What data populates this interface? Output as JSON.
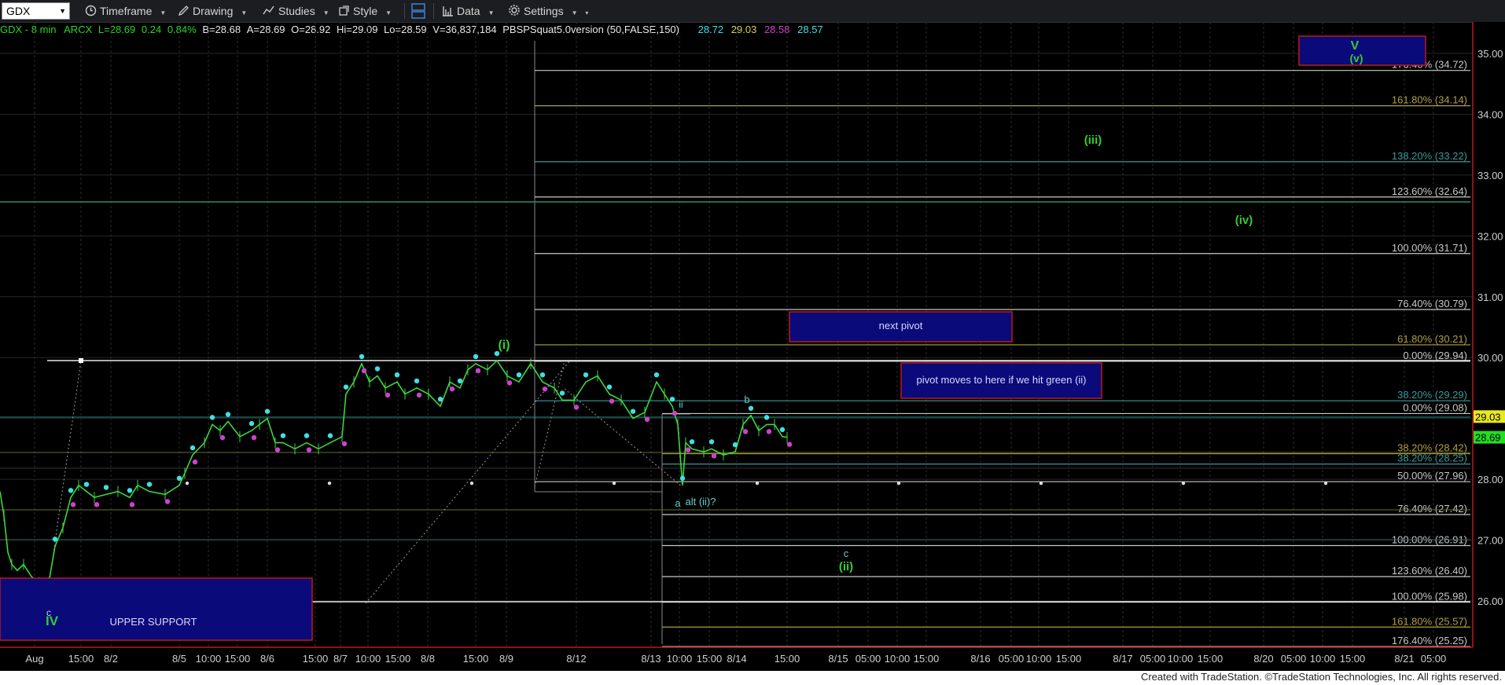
{
  "toolbar": {
    "symbol": "GDX",
    "timeframe": "Timeframe",
    "drawing": "Drawing",
    "studies": "Studies",
    "style": "Style",
    "data": "Data",
    "settings": "Settings"
  },
  "info": {
    "symbol_interval": "GDX - 8 min",
    "exchange": "ARCX",
    "last": "L=28.69",
    "change": "0.24",
    "change_pct": "0.84%",
    "bid": "B=28.68",
    "ask": "A=28.69",
    "open": "O=28.92",
    "high": "Hi=29.09",
    "low": "Lo=28.59",
    "volume": "V=36,837,184",
    "study": "PBSPSquat5.0version (50,FALSE,150)",
    "study_v1": "28.72",
    "study_v2": "29.03",
    "study_v3": "28.58",
    "study_v4": "28.57"
  },
  "colors": {
    "up": "#22c22a",
    "down": "#e03030",
    "candle": "#3dd63d",
    "dot_cyan": "#3fe0e0",
    "dot_magenta": "#d040d0",
    "wave_green": "#33cc33",
    "fib_gray": "#c8c8c8",
    "box_fill": "#0a0a7a",
    "box_border": "#c01818"
  },
  "price_axis": {
    "labels": [
      "35.00",
      "34.00",
      "33.00",
      "32.00",
      "31.00",
      "30.00",
      "29.00",
      "28.00",
      "27.00",
      "26.00"
    ],
    "last_price": "28.69",
    "marker_price": "29.03"
  },
  "time_axis": {
    "labels": [
      "Aug",
      "15:00",
      "8/2",
      "8/5",
      "10:00",
      "15:00",
      "8/6",
      "15:00",
      "8/7",
      "10:00",
      "15:00",
      "8/8",
      "15:00",
      "8/9",
      "8/12",
      "8/13",
      "10:00",
      "15:00",
      "8/14",
      "15:00",
      "8/15",
      "05:00",
      "10:00",
      "15:00",
      "8/16",
      "05:00",
      "10:00",
      "15:00",
      "8/17",
      "05:00",
      "10:00",
      "15:00",
      "8/20",
      "05:00",
      "10:00",
      "15:00",
      "8/21",
      "05:00"
    ]
  },
  "fib_levels": [
    {
      "label": "176.40% (34.72)",
      "price": 34.72,
      "color": "#c8c8c8"
    },
    {
      "label": "161.80% (34.14)",
      "price": 34.14,
      "color": "#b0a040"
    },
    {
      "label": "138.20% (33.22)",
      "price": 33.22,
      "color": "#3a9a9a"
    },
    {
      "label": "123.60% (32.64)",
      "price": 32.64,
      "color": "#c8c8c8"
    },
    {
      "label": "100.00% (31.71)",
      "price": 31.71,
      "color": "#c8c8c8"
    },
    {
      "label": "76.40% (30.79)",
      "price": 30.79,
      "color": "#c8c8c8"
    },
    {
      "label": "61.80% (30.21)",
      "price": 30.21,
      "color": "#b0a040"
    },
    {
      "label": "0.00% (29.94)",
      "price": 29.94,
      "color": "#c8c8c8"
    },
    {
      "label": "38.20% (29.29)",
      "price": 29.29,
      "color": "#3a9a9a"
    },
    {
      "label": "0.00% (29.08)",
      "price": 29.08,
      "color": "#c8c8c8"
    },
    {
      "label": "38.20% (28.42)",
      "price": 28.42,
      "color": "#b0a040"
    },
    {
      "label": "38.20% (28.25)",
      "price": 28.25,
      "color": "#3a9a9a"
    },
    {
      "label": "50.00% (27.96)",
      "price": 27.96,
      "color": "#c8c8c8"
    },
    {
      "label": "76.40% (27.42)",
      "price": 27.42,
      "color": "#c8c8c8"
    },
    {
      "label": "100.00% (26.91)",
      "price": 26.91,
      "color": "#c8c8c8"
    },
    {
      "label": "123.60% (26.40)",
      "price": 26.4,
      "color": "#c8c8c8"
    },
    {
      "label": "100.00% (25.98)",
      "price": 25.98,
      "color": "#c8c8c8"
    },
    {
      "label": "161.80% (25.57)",
      "price": 25.57,
      "color": "#b0a040"
    },
    {
      "label": "176.40% (25.25)",
      "price": 25.25,
      "color": "#c8c8c8"
    }
  ],
  "wave_labels": [
    {
      "text": "(i)",
      "color": "#33cc33"
    },
    {
      "text": "(iii)",
      "color": "#33cc33"
    },
    {
      "text": "(iv)",
      "color": "#33cc33"
    },
    {
      "text": "(ii)",
      "color": "#33cc33"
    },
    {
      "text": "V",
      "color": "#33cc33"
    },
    {
      "text": "(v)",
      "color": "#33cc33"
    },
    {
      "text": "IV",
      "color": "#33cc33"
    },
    {
      "text": "c",
      "color": "#cccccc"
    },
    {
      "text": "a",
      "color": "#66cccc"
    },
    {
      "text": "b",
      "color": "#66cccc"
    },
    {
      "text": "c",
      "color": "#66cccc"
    },
    {
      "text": "ii",
      "color": "#66cccc"
    },
    {
      "text": "alt (ii)?",
      "color": "#66cccc"
    }
  ],
  "boxes": {
    "next_pivot": "next pivot",
    "pivot_moves": "pivot moves to here if we hit green (ii)",
    "upper_support": "UPPER SUPPORT"
  },
  "watermark": "Created with TradeStation. ©TradeStation Technologies, Inc. All rights reserved."
}
